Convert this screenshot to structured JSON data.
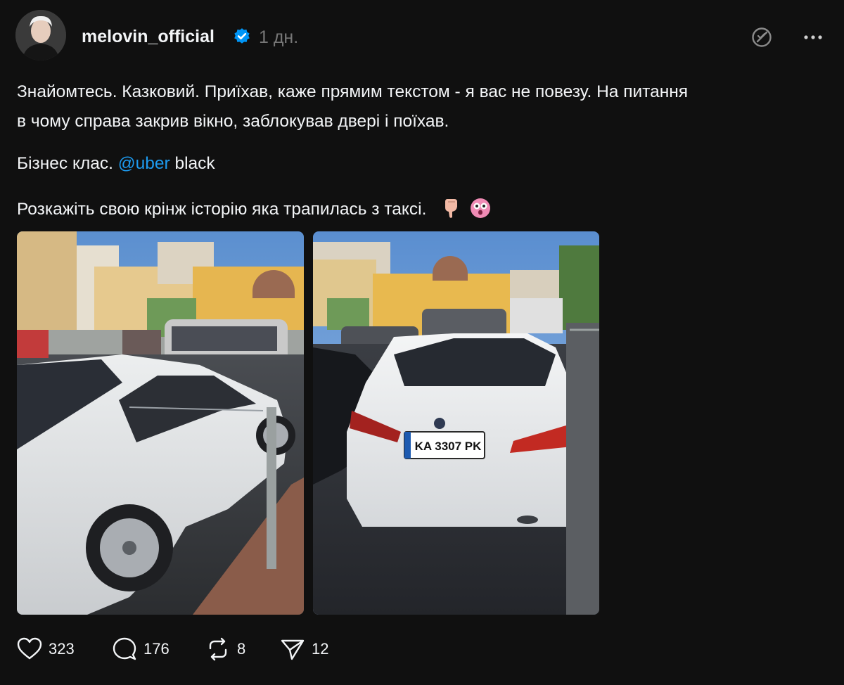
{
  "post": {
    "author": {
      "username": "melovin_official",
      "verified": true,
      "time_ago": "1 дн."
    },
    "text": {
      "line1": "Знайомтесь. Казковий. Приїхав, каже прямим текстом - я вас не повезу. На питання",
      "line2": "в чому справа закрив вікно, заблокував двері і поїхав.",
      "line3_prefix": "Бізнес клас. ",
      "line3_mention": "@uber",
      "line3_suffix": " black",
      "line4": "Розкажіть свою крінж історію яка трапилась з таксі."
    },
    "photos": {
      "photo2_plate": "KA 3307 PK"
    },
    "stats": {
      "likes": "323",
      "replies": "176",
      "reposts": "8",
      "shares": "12"
    }
  },
  "colors": {
    "background": "#101010",
    "text": "#f3f5f7",
    "muted": "#777777",
    "mention": "#1d9bf0",
    "verified_badge": "#0095f6"
  }
}
